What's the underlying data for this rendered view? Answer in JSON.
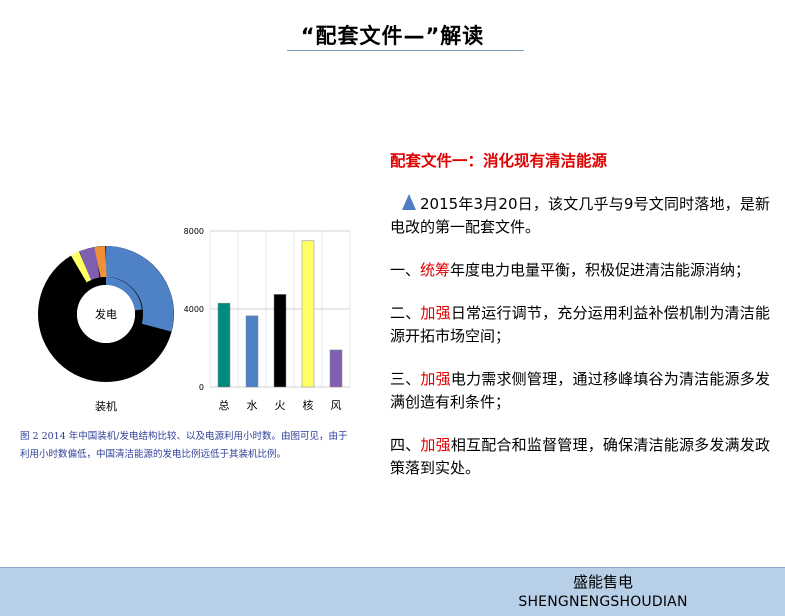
{
  "slide": {
    "title": "“配套文件—”解读"
  },
  "figure": {
    "donut_center_label": "发电",
    "donut_bottom_label": "装机",
    "caption_line1": "图 2   2014 年中国装机/发电结构比较、以及电源利用小时数。由图可见，由于",
    "caption_line2": "利用小时数偏低，中国清洁能源的发电比例远低于其装机比例。",
    "colors": {
      "hydro": "#4f81c7",
      "thermal": "#000000",
      "nuclear": "#ffff66",
      "wind": "#7f5fb0",
      "other": "#f0903a",
      "total": "#008b7d"
    }
  },
  "chart_data": {
    "type": "bar",
    "categories": [
      "总",
      "水",
      "火",
      "核",
      "风"
    ],
    "values": [
      4300,
      3650,
      4750,
      7500,
      1900
    ],
    "ylim": [
      0,
      8000
    ],
    "yticks": [
      "0",
      "4000",
      "8000"
    ],
    "colors": [
      "#008b7d",
      "#4f81c7",
      "#000000",
      "#ffff66",
      "#7f5fb0"
    ],
    "grid": true
  },
  "content": {
    "heading": "配套文件一：消化现有清洁能源",
    "intro": "2015年3月20日，该文几乎与9号文同时落地，是新电改的第一配套文件。",
    "items": [
      {
        "prefix": "一、",
        "keyword": "统筹",
        "text": "年度电力电量平衡，积极促进清洁能源消纳；"
      },
      {
        "prefix": "二、",
        "keyword": "加强",
        "text": "日常运行调节，充分运用利益补偿机制为清洁能源开拓市场空间；"
      },
      {
        "prefix": "三、",
        "keyword": "加强",
        "text": "电力需求侧管理，通过移峰填谷为清洁能源多发满创造有利条件；"
      },
      {
        "prefix": "四、",
        "keyword": "加强",
        "text": "相互配合和监督管理，确保清洁能源多发满发政策落到实处。"
      }
    ]
  },
  "footer": {
    "name_cn": "盛能售电",
    "name_en": "SHENGNENGSHOUDIAN"
  }
}
